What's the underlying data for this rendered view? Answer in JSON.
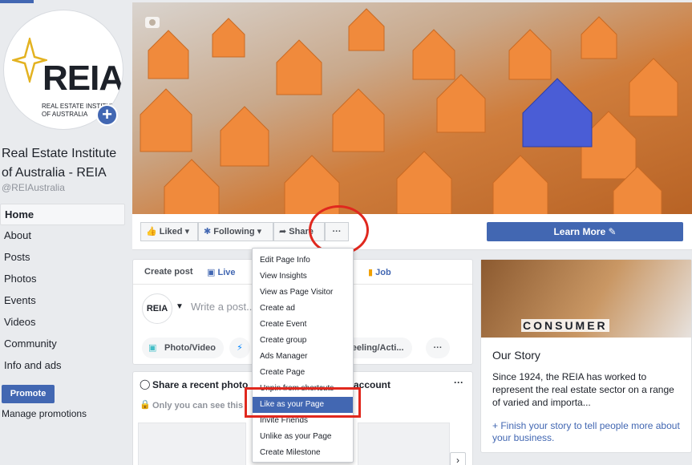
{
  "page": {
    "name": "Real Estate Institute of Australia - REIA",
    "handle": "@REIAustralia"
  },
  "avatar": {
    "logo_text": "REIA",
    "sub_line1": "REAL ESTATE INSTITUTE",
    "sub_line2": "OF AUSTRALIA",
    "plus": "+"
  },
  "sidebar": {
    "items": [
      {
        "label": "Home",
        "active": true
      },
      {
        "label": "About"
      },
      {
        "label": "Posts"
      },
      {
        "label": "Photos"
      },
      {
        "label": "Events"
      },
      {
        "label": "Videos"
      },
      {
        "label": "Community"
      },
      {
        "label": "Info and ads"
      }
    ],
    "promote_label": "Promote",
    "manage_promotions": "Manage promotions"
  },
  "actions": {
    "liked": "Liked",
    "following": "Following",
    "share": "Share",
    "more": "···",
    "learn_more": "Learn More"
  },
  "create_post": {
    "header": "Create post",
    "live": "Live",
    "job": "Job",
    "avatar_text": "REIA",
    "placeholder": "Write a post...",
    "photo_video": "Photo/Video",
    "feeling": "Feeling/Acti...",
    "more": "···"
  },
  "share_photo": {
    "title": "Share a recent photo",
    "title_end": "account",
    "visibility": "Only you can see this",
    "more": "···"
  },
  "story": {
    "image_text": "CONSUMER",
    "title": "Our Story",
    "body": "Since 1924, the REIA has worked to represent the real estate sector on a range of varied and importa...",
    "link": "+ Finish your story to tell people more about your business."
  },
  "dropdown": {
    "items": [
      "Edit Page Info",
      "View Insights",
      "View as Page Visitor",
      "Create ad",
      "Create Event",
      "Create group",
      "Ads Manager",
      "Create Page",
      "Unpin from shortcuts",
      "Like as your Page",
      "Invite Friends",
      "Unlike as your Page",
      "Create Milestone"
    ],
    "highlighted_index": 9
  },
  "colors": {
    "brand": "#4267b2",
    "annotation_red": "#e0281e",
    "page_bg": "#e9ebee"
  }
}
